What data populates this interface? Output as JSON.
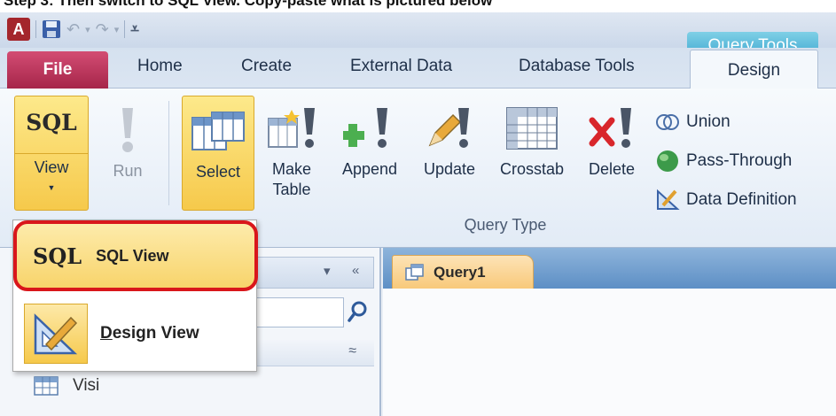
{
  "caption": {
    "text": "Step 3: Then switch to SQL View. Copy-paste what is pictured below"
  },
  "titlebar": {
    "app_icon": "A",
    "context_tab": "Query Tools"
  },
  "tabs": {
    "file": "File",
    "home": "Home",
    "create": "Create",
    "external_data": "External Data",
    "database_tools": "Database Tools",
    "design": "Design"
  },
  "ribbon": {
    "view": {
      "glyph": "SQL",
      "label": "View"
    },
    "run": {
      "label": "Run"
    },
    "select": {
      "label": "Select"
    },
    "make_table": {
      "label1": "Make",
      "label2": "Table"
    },
    "append": {
      "label": "Append"
    },
    "update": {
      "label": "Update"
    },
    "crosstab": {
      "label": "Crosstab"
    },
    "delete": {
      "label": "Delete"
    },
    "union": {
      "label": "Union"
    },
    "pass_through": {
      "label": "Pass-Through"
    },
    "data_definition": {
      "label": "Data Definition"
    },
    "group_label": "Query Type"
  },
  "view_menu": {
    "sql_glyph": "SQL",
    "sql_label": "SQL View",
    "design_label_first": "D",
    "design_label_rest": "esign View"
  },
  "nav": {
    "table_item": "Visi"
  },
  "document": {
    "tab_label": "Query1"
  },
  "colors": {
    "highlight": "#f6c94b",
    "file_tab": "#a6264a",
    "context_tab": "#3aa5cf",
    "callout_border": "#d9161b"
  }
}
